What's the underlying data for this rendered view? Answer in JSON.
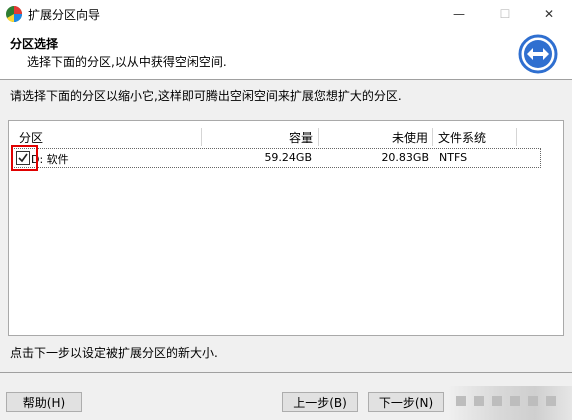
{
  "window": {
    "title": "扩展分区向导",
    "min_glyph": "—",
    "max_glyph": "☐",
    "close_glyph": "✕"
  },
  "header": {
    "title": "分区选择",
    "subtitle": "选择下面的分区,以从中获得空闲空间."
  },
  "instruction": "请选择下面的分区以缩小它,这样即可腾出空闲空间来扩展您想扩大的分区.",
  "partition_table": {
    "columns": [
      "分区",
      "容量",
      "未使用",
      "文件系统"
    ],
    "rows": [
      {
        "checked": true,
        "partition": "D: 软件",
        "capacity": "59.24GB",
        "unused": "20.83GB",
        "filesystem": "NTFS"
      }
    ]
  },
  "bottom_note": "点击下一步以设定被扩展分区的新大小.",
  "buttons": {
    "help": "帮助(H)",
    "back": "上一步(B)",
    "next": "下一步(N)"
  },
  "colors": {
    "highlight": "#e00000",
    "icon_blue": "#2f6fd0"
  },
  "icons": {
    "app": "partition-app-icon",
    "header": "resize-arrows-icon"
  }
}
